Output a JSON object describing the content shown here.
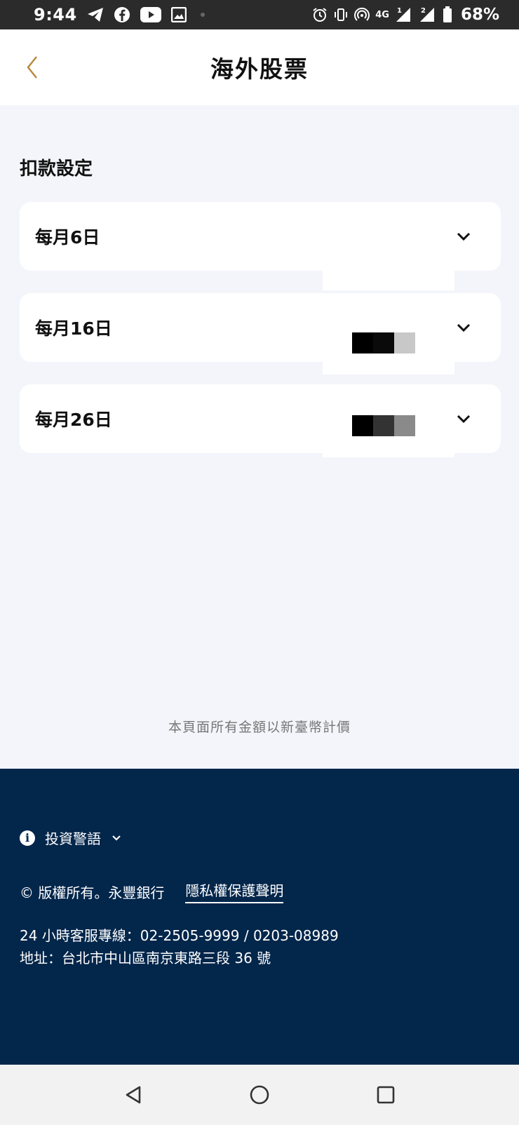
{
  "status_bar": {
    "time": "9:44",
    "network": "4G",
    "sim1": "1",
    "sim2": "2",
    "battery": "68%"
  },
  "header": {
    "title": "海外股票"
  },
  "section": {
    "title": "扣款設定"
  },
  "debit_dates": [
    {
      "label": "每月6日"
    },
    {
      "label": "每月16日"
    },
    {
      "label": "每月26日"
    }
  ],
  "note": "本頁面所有金額以新臺幣計價",
  "footer": {
    "warning_label": "投資警語",
    "copyright": "© 版權所有。永豐銀行",
    "privacy_link": "隱私權保護聲明",
    "hotline": "24 小時客服專線：02-2505-9999 / 0203-08989",
    "address": "地址：台北市中山區南京東路三段 36 號"
  },
  "colors": {
    "accent_gold": "#b8873a",
    "footer_bg": "#03264b",
    "page_bg": "#f3f5fa"
  }
}
